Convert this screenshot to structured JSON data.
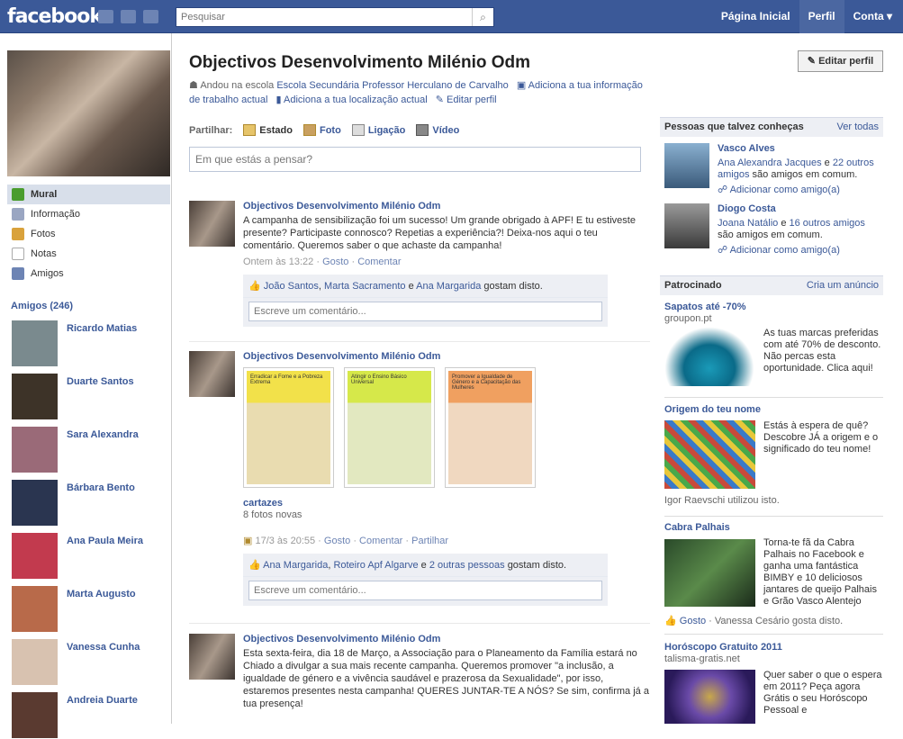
{
  "topbar": {
    "logo": "facebook",
    "search_placeholder": "Pesquisar",
    "nav": [
      "Página Inicial",
      "Perfil",
      "Conta ▾"
    ]
  },
  "profile": {
    "title": "Objectivos Desenvolvimento Milénio Odm",
    "edit_button": "✎ Editar perfil",
    "info": {
      "school_prefix": "Andou na escola",
      "school": "Escola Secundária Professor Herculano de Carvalho",
      "add_work": "Adiciona a tua informação de trabalho actual",
      "add_location": "Adiciona a tua localização actual",
      "edit": "Editar perfil"
    }
  },
  "leftnav": [
    {
      "label": "Mural",
      "icon": "wall-icon",
      "color": "#4a9c2e"
    },
    {
      "label": "Informação",
      "icon": "info-icon",
      "color": "#9aa6c2"
    },
    {
      "label": "Fotos",
      "icon": "photos-icon",
      "color": "#d9a23c"
    },
    {
      "label": "Notas",
      "icon": "notes-icon",
      "color": "#ccc"
    },
    {
      "label": "Amigos",
      "icon": "friends-icon",
      "color": "#6d84b4"
    }
  ],
  "friends": {
    "header": "Amigos (246)",
    "items": [
      {
        "name": "Ricardo Matias",
        "color": "#7a8a8e"
      },
      {
        "name": "Duarte Santos",
        "color": "#3d3328"
      },
      {
        "name": "Sara Alexandra",
        "color": "#9a6a78"
      },
      {
        "name": "Bárbara Bento",
        "color": "#2a3550"
      },
      {
        "name": "Ana Paula Meira",
        "color": "#c23a4e"
      },
      {
        "name": "Marta Augusto",
        "color": "#b86a4a"
      },
      {
        "name": "Vanessa Cunha",
        "color": "#d8c2b0"
      },
      {
        "name": "Andreia Duarte",
        "color": "#5a3a30"
      }
    ]
  },
  "share": {
    "label": "Partilhar:",
    "options": [
      "Estado",
      "Foto",
      "Ligação",
      "Vídeo"
    ],
    "placeholder": "Em que estás a pensar?"
  },
  "posts": [
    {
      "author": "Objectivos Desenvolvimento Milénio Odm",
      "text": "A campanha de sensibilização foi um sucesso! Um grande obrigado à APF! E tu estiveste presente? Participaste connosco? Repetias a experiência?! Deixa-nos aqui o teu comentário. Queremos saber o que achaste da campanha!",
      "time": "Ontem às 13:22",
      "actions": [
        "Gosto",
        "Comentar"
      ],
      "likes": {
        "names": [
          "João Santos",
          "Marta Sacramento",
          "Ana Margarida"
        ],
        "suffix": "gostam disto."
      },
      "comment_placeholder": "Escreve um comentário..."
    },
    {
      "author": "Objectivos Desenvolvimento Milénio Odm",
      "album": "cartazes",
      "album_sub": "8 fotos novas",
      "time": "17/3 às 20:55",
      "actions": [
        "Gosto",
        "Comentar",
        "Partilhar"
      ],
      "posters": [
        {
          "title": "Erradicar a Fome e a Pobreza Extrema",
          "color": "#f2e14a"
        },
        {
          "title": "Atingir o Ensino Básico Universal",
          "color": "#d6e84a"
        },
        {
          "title": "Promover a Igualdade de Género e a Capacitação das Mulheres",
          "color": "#f0a060"
        }
      ],
      "likes": {
        "names": [
          "Ana Margarida",
          "Roteiro Apf Algarve",
          "2 outras pessoas"
        ],
        "suffix": "gostam disto."
      },
      "comment_placeholder": "Escreve um comentário..."
    },
    {
      "author": "Objectivos Desenvolvimento Milénio Odm",
      "text": "Esta sexta-feira, dia 18 de Março, a Associação para o Planeamento da Família estará no Chiado a divulgar a sua mais recente campanha. Queremos promover \"a inclusão, a igualdade de género e a vivência saudável e prazerosa da Sexualidade\", por isso, estaremos presentes nesta campanha! QUERES JUNTAR-TE A NÓS? Se sim, confirma já a tua presença!"
    }
  ],
  "pymk": {
    "header": "Pessoas que talvez conheças",
    "see_all": "Ver todas",
    "items": [
      {
        "name": "Vasco Alves",
        "mutual_name": "Ana Alexandra Jacques",
        "mutual_count": "22 outros amigos",
        "suffix": "são amigos em comum.",
        "add": "Adicionar como amigo(a)",
        "color": "#5a7a9a"
      },
      {
        "name": "Diogo Costa",
        "mutual_name": "Joana Natálio",
        "mutual_count": "16 outros amigos",
        "suffix": "são amigos em comum.",
        "add": "Adicionar como amigo(a)",
        "color": "#6a6a6a"
      }
    ]
  },
  "sponsored": {
    "header": "Patrocinado",
    "create": "Cria um anúncio",
    "ads": [
      {
        "title": "Sapatos até -70%",
        "source": "groupon.pt",
        "body": "As tuas marcas preferidas com até 70% de desconto. Não percas esta oportunidade. Clica aqui!",
        "color": "#1a9ab8"
      },
      {
        "title": "Origem do teu nome",
        "body": "Estás à espera de quê? Descobre JÁ a origem e o significado do teu nome!",
        "footer": "Igor Raevschi utilizou isto.",
        "color": "#c84a3a"
      },
      {
        "title": "Cabra Palhais",
        "body": "Torna-te fã da Cabra Palhais no Facebook e ganha uma fantástica BIMBY e 10 deliciosos jantares de queijo Palhais e Grão Vasco Alentejo",
        "footer_like": "Gosto",
        "footer_text": "Vanessa Cesário gosta disto.",
        "color": "#3a6a3a"
      },
      {
        "title": "Horóscopo Gratuito 2011",
        "source": "talisma-gratis.net",
        "body": "Quer saber o que o espera em 2011? Peça agora Grátis o seu Horóscopo Pessoal e",
        "color": "#4a3a8a"
      }
    ]
  }
}
